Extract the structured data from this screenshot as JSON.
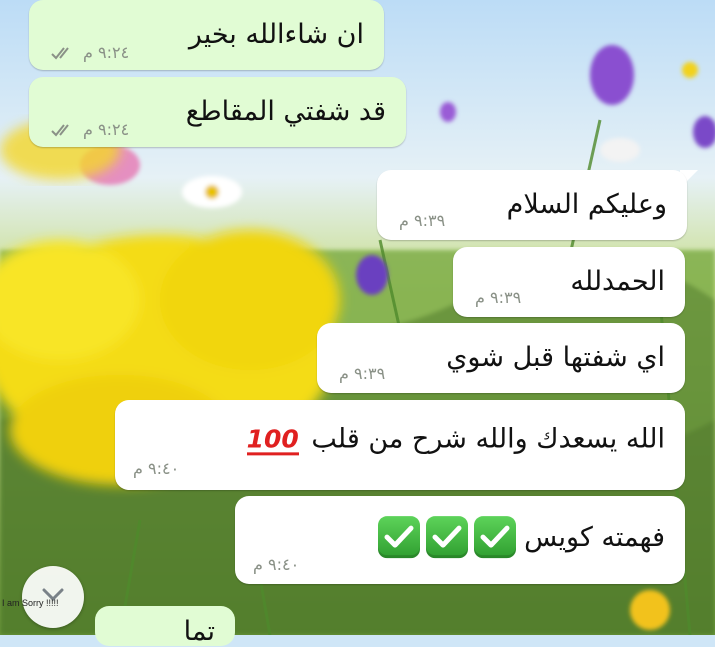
{
  "wallpaper_colors": {
    "sky": "#cfe6f7",
    "meadow": "#9dc46a",
    "flower_yellow": "#f7e21a",
    "flower_purple": "#8a4fd0",
    "flower_pink": "#e58fc0"
  },
  "messages": [
    {
      "text": "ان شاءالله بخير",
      "time": "٩:٢٤ م",
      "direction": "out",
      "status": "read-icon"
    },
    {
      "text": "قد شفتي المقاطع",
      "time": "٩:٢٤ م",
      "direction": "out",
      "status": "read-icon"
    },
    {
      "text": "وعليكم السلام",
      "time": "٩:٣٩ م",
      "direction": "in"
    },
    {
      "text": "الحمدلله",
      "time": "٩:٣٩ م",
      "direction": "in"
    },
    {
      "text": "اي شفتها قبل شوي",
      "time": "٩:٣٩ م",
      "direction": "in"
    },
    {
      "text": "الله يسعدك والله شرح من قلب",
      "emoji": "100",
      "time": "٩:٤٠ م",
      "direction": "in"
    },
    {
      "text": "فهمته كويس",
      "emoji": "check-mark-button-icon x3",
      "time": "٩:٤٠ م",
      "direction": "in"
    }
  ],
  "bottom_partial_text": "تما",
  "overlay_text": "I am Sorry !!!!!",
  "scroll_button": "scroll-down-icon"
}
